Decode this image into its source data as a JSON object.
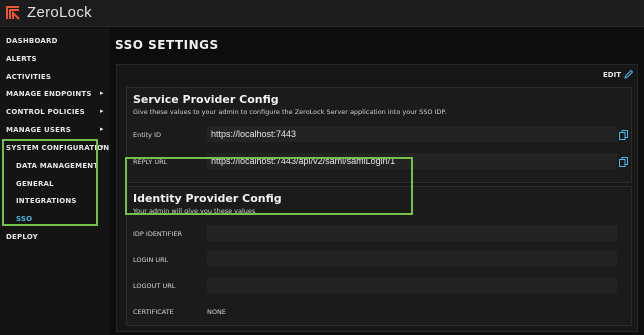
{
  "app": {
    "title": "ZeroLock",
    "brand_color": "#e8562f",
    "accent": "#4db6e6",
    "highlight": "#74c14a"
  },
  "sidebar": {
    "items": [
      {
        "label": "DASHBOARD"
      },
      {
        "label": "ALERTS"
      },
      {
        "label": "ACTIVITIES"
      },
      {
        "label": "MANAGE ENDPOINTS"
      },
      {
        "label": "CONTROL POLICIES"
      },
      {
        "label": "MANAGE USERS"
      },
      {
        "label": "SYSTEM CONFIGURATION"
      },
      {
        "label": "DATA MANAGEMENT"
      },
      {
        "label": "GENERAL"
      },
      {
        "label": "INTEGRATIONS"
      },
      {
        "label": "SSO"
      },
      {
        "label": "DEPLOY"
      }
    ]
  },
  "main": {
    "page_title": "SSO SETTINGS",
    "edit_label": "EDIT",
    "service_provider": {
      "title": "Service Provider Config",
      "subtitle": "Give these values to your admin to configure the ZeroLock Server application into your SSO IDP.",
      "fields": [
        {
          "label": "Entity ID",
          "value": "https://localhost:7443"
        },
        {
          "label": "REPLY URL",
          "value": "https://localhost:7443/api/v2/saml/samlLogin/1"
        }
      ]
    },
    "identity_provider": {
      "title": "Identity Provider Config",
      "subtitle": "Your admin will give you these values",
      "fields": [
        {
          "label": "IDP IDENTIFIER",
          "value": ""
        },
        {
          "label": "LOGIN URL",
          "value": ""
        },
        {
          "label": "LOGOUT URL",
          "value": ""
        },
        {
          "label": "CERTIFICATE",
          "value": "NONE"
        }
      ]
    }
  }
}
